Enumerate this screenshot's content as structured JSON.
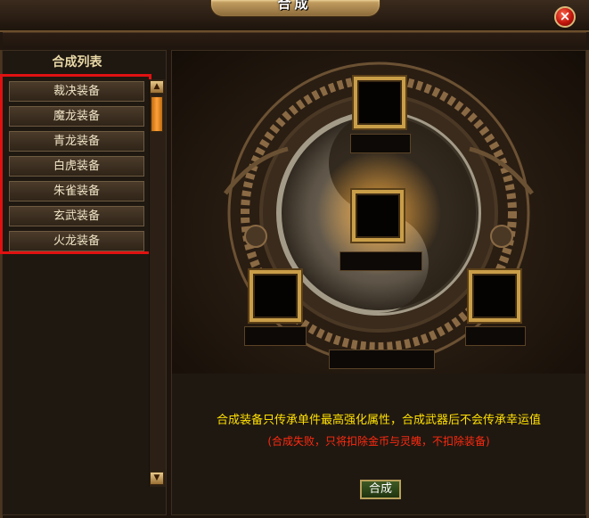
{
  "window": {
    "title": "合成",
    "close_icon": "×"
  },
  "list": {
    "header": "合成列表",
    "items": [
      "裁决装备",
      "魔龙装备",
      "青龙装备",
      "白虎装备",
      "朱雀装备",
      "玄武装备",
      "火龙装备"
    ]
  },
  "scrollbar": {
    "up_icon": "▲",
    "down_icon": "▼"
  },
  "info": {
    "line1": "合成装备只传承单件最高强化属性，合成武器后不会传承幸运值",
    "line2": "(合成失败，只将扣除金币与灵魄，不扣除装备)"
  },
  "craft_button": "合成",
  "colors": {
    "highlight_border": "#e01111",
    "info_yellow": "#ffe000",
    "info_red": "#ff2a10",
    "slot_gold": "#c99e48"
  }
}
